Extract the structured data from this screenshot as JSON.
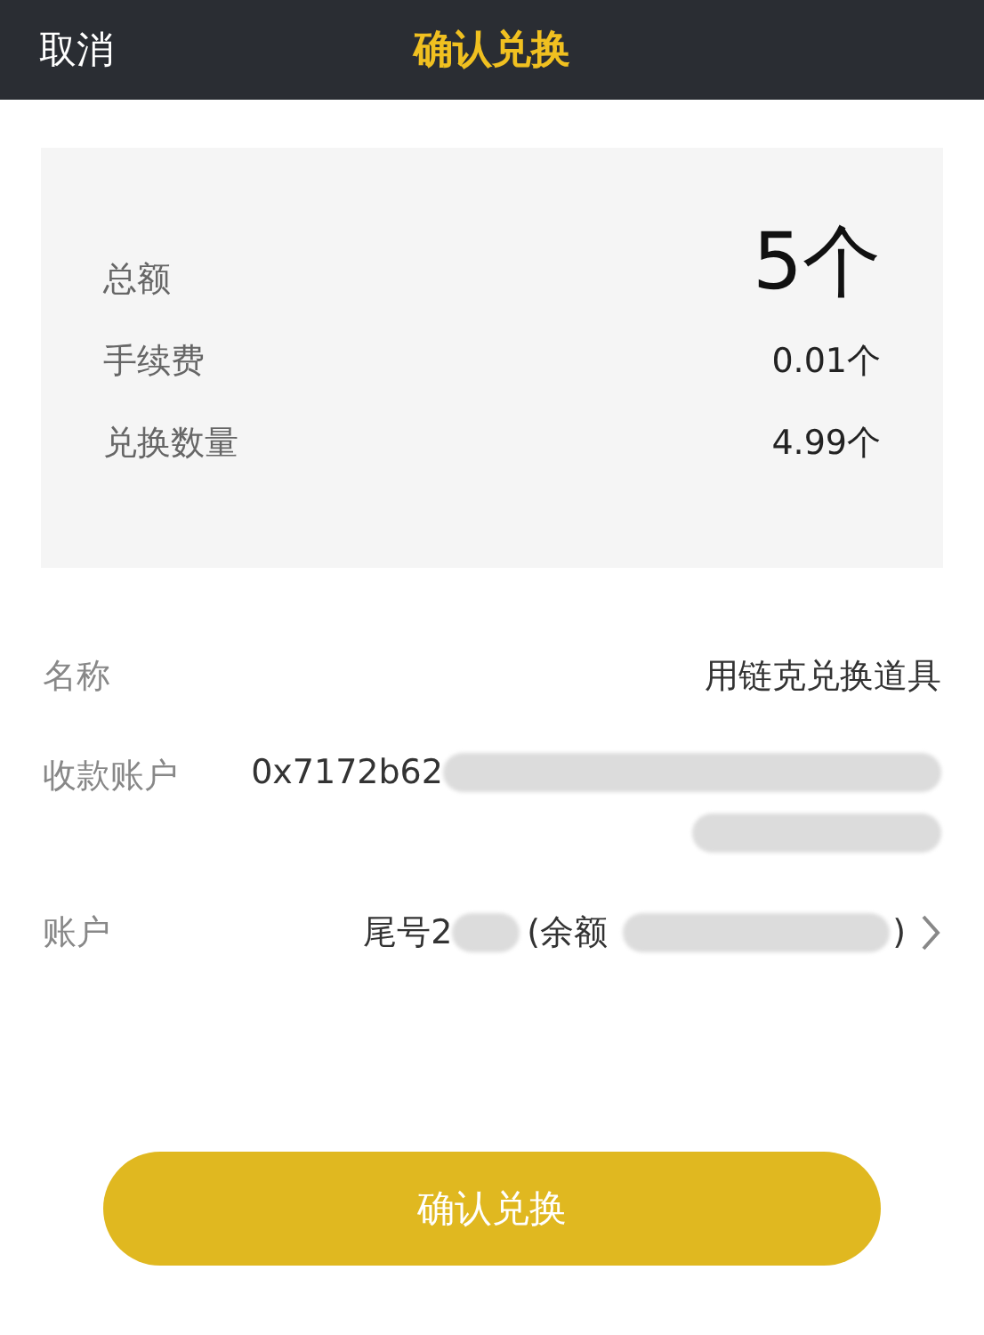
{
  "header": {
    "cancel": "取消",
    "title": "确认兑换"
  },
  "summary": {
    "total_label": "总额",
    "total_value": "5个",
    "rows": [
      {
        "label": "手续费",
        "value": "0.01个"
      },
      {
        "label": "兑换数量",
        "value": "4.99个"
      }
    ]
  },
  "details": {
    "name": {
      "label": "名称",
      "value": "用链克兑换道具"
    },
    "payee": {
      "label": "收款账户",
      "value": "0x7172b62"
    },
    "account": {
      "label": "账户",
      "tail": "尾号2",
      "balance_open": "(余额",
      "balance_close": ")"
    }
  },
  "confirm_button": "确认兑换"
}
